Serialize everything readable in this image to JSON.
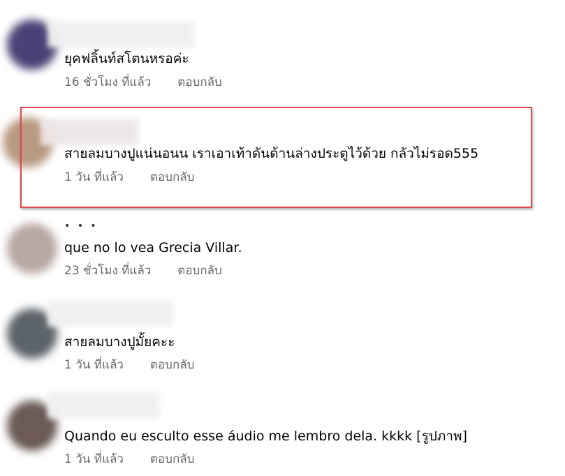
{
  "comments": [
    {
      "text": "ยุคฟลิ้นท์สโตนหรอค่ะ",
      "time": "16 ชั่วโมง ที่แล้ว",
      "reply": "ตอบกลับ",
      "avatar_color": "#4a4276"
    },
    {
      "text": "สายลมบางปูแน่นอนน เราเอาเท้าดันด้านล่างประตูไว้ด้วย กลัวไม่รอด555",
      "time": "1 วัน ที่แล้ว",
      "reply": "ตอบกลับ",
      "avatar_color": "#b89a80"
    },
    {
      "text": "que no lo vea Grecia Villar.",
      "time": "23 ชั่วโมง ที่แล้ว",
      "reply": "ตอบกลับ",
      "avatar_color": "#b8a7a2"
    },
    {
      "text": "สายลมบางปูมั้ยคะะ",
      "time": "1 วัน ที่แล้ว",
      "reply": "ตอบกลับ",
      "avatar_color": "#5c6369"
    },
    {
      "text": "Quando eu esculto esse áudio me lembro dela. kkkk [รูปภาพ]",
      "time": "1 วัน ที่แล้ว",
      "reply": "ตอบกลับ",
      "avatar_color": "#6b5a55"
    }
  ],
  "highlight_color": "#e0484c",
  "meta_color": "#65676b"
}
